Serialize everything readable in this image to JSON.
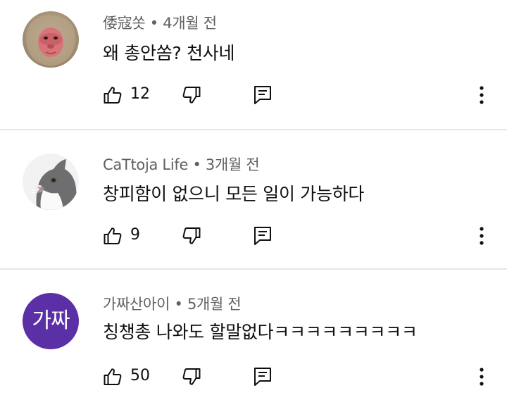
{
  "comments": [
    {
      "author": "倭寇쏫",
      "time": "4개월 전",
      "text": "왜 총안쏨? 천사네",
      "likes": "12",
      "avatar": "monkey-face"
    },
    {
      "author": "CaTtoja Life",
      "time": "3개월 전",
      "text": "창피함이 없으니 모든 일이 가능하다",
      "likes": "9",
      "avatar": "cat-photo"
    },
    {
      "author": "가짜산아이",
      "time": "5개월 전",
      "text": "칭챙총 나와도 할말없다ㅋㅋㅋㅋㅋㅋㅋㅋㅋ",
      "likes": "50",
      "avatar_text": "가짜",
      "avatar_color": "#5b2fa6"
    }
  ],
  "separator": " • ",
  "icons": {
    "like": "thumbs-up-outline",
    "dislike": "thumbs-down-outline",
    "reply": "comment-reply",
    "more": "vertical-ellipsis"
  }
}
